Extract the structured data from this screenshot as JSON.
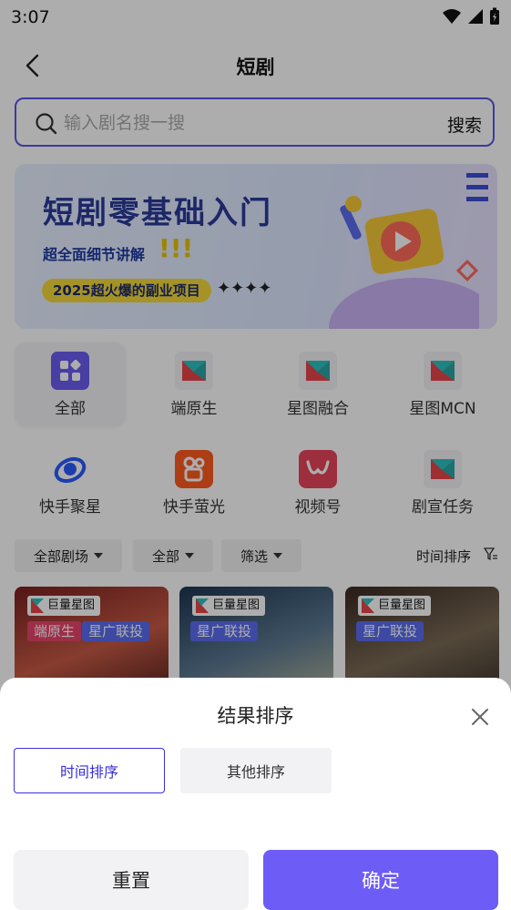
{
  "status": {
    "time": "3:07"
  },
  "header": {
    "title": "短剧"
  },
  "search": {
    "placeholder": "输入剧名搜一搜",
    "button": "搜索"
  },
  "banner": {
    "title": "短剧零基础入门",
    "subtitle": "超全面细节讲解",
    "exclaim": "!!!",
    "pill": "2025超火爆的副业项目",
    "stars": "✦✦✦✦"
  },
  "categories": [
    {
      "label": "全部",
      "icon": "grid-icon"
    },
    {
      "label": "端原生",
      "icon": "xingtu-logo-icon"
    },
    {
      "label": "星图融合",
      "icon": "xingtu-logo-icon"
    },
    {
      "label": "星图MCN",
      "icon": "xingtu-logo-icon"
    },
    {
      "label": "快手聚星",
      "icon": "kuaishou-juxing-icon"
    },
    {
      "label": "快手萤光",
      "icon": "kuaishou-icon"
    },
    {
      "label": "视频号",
      "icon": "channels-icon"
    },
    {
      "label": "剧宣任务",
      "icon": "xingtu-logo-icon"
    }
  ],
  "filters": {
    "chips": [
      "全部剧场",
      "全部",
      "筛选"
    ],
    "sort_label": "时间排序"
  },
  "cards": [
    {
      "brand": "巨量星图",
      "tags": [
        "端原生",
        "星广联投"
      ]
    },
    {
      "brand": "巨量星图",
      "tags": [
        "星广联投"
      ]
    },
    {
      "brand": "巨量星图",
      "tags": [
        "星广联投"
      ]
    }
  ],
  "sheet": {
    "title": "结果排序",
    "options": [
      "时间排序",
      "其他排序"
    ],
    "selected": "时间排序",
    "reset": "重置",
    "confirm": "确定"
  },
  "colors": {
    "accent": "#5b54e6",
    "confirm": "#6e5cf6",
    "tag_red": "#e8456b",
    "tag_blue": "#5b6cf0"
  }
}
